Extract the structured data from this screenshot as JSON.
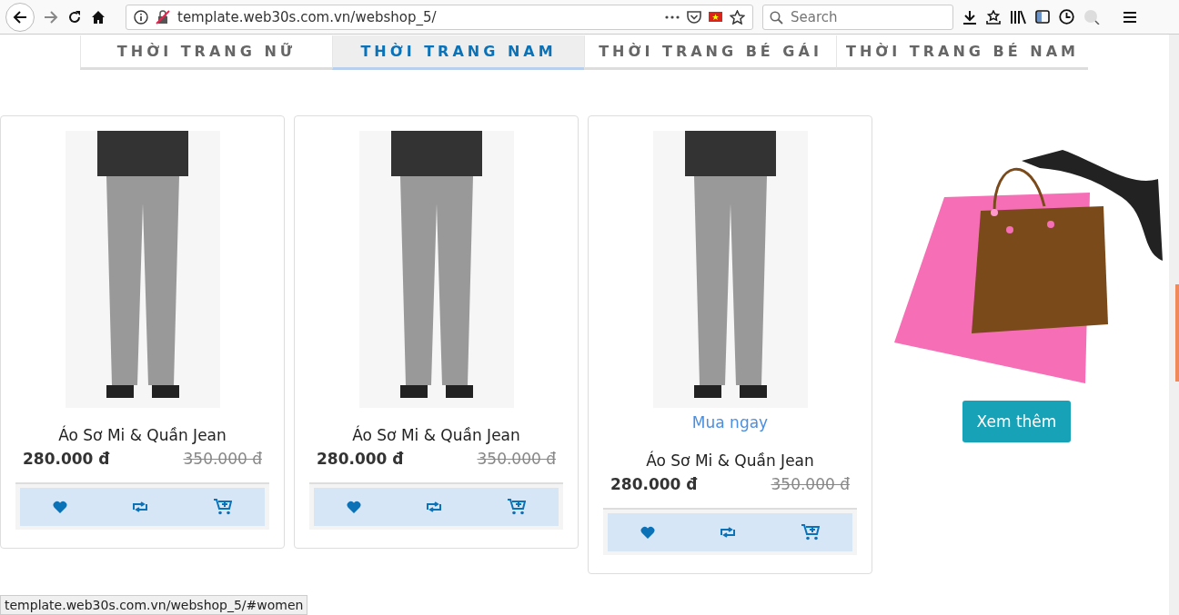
{
  "browser": {
    "url": "template.web30s.com.vn/webshop_5/",
    "search_placeholder": "Search"
  },
  "tabs": [
    {
      "label": "THỜI TRANG NỮ",
      "selected": false
    },
    {
      "label": "THỜI TRANG NAM",
      "selected": true
    },
    {
      "label": "THỜI TRANG BÉ GÁI",
      "selected": false
    },
    {
      "label": "THỜI TRANG BÉ NAM",
      "selected": false
    }
  ],
  "products": [
    {
      "title": "Áo Sơ Mi & Quần Jean",
      "price": "280.000 đ",
      "old_price": "350.000 đ"
    },
    {
      "title": "Áo Sơ Mi & Quần Jean",
      "price": "280.000 đ",
      "old_price": "350.000 đ"
    },
    {
      "title": "Áo Sơ Mi & Quần Jean",
      "price": "280.000 đ",
      "old_price": "350.000 đ",
      "buy_now": "Mua ngay"
    }
  ],
  "more_button": "Xem thêm",
  "status_bar": "template.web30s.com.vn/webshop_5/#women"
}
